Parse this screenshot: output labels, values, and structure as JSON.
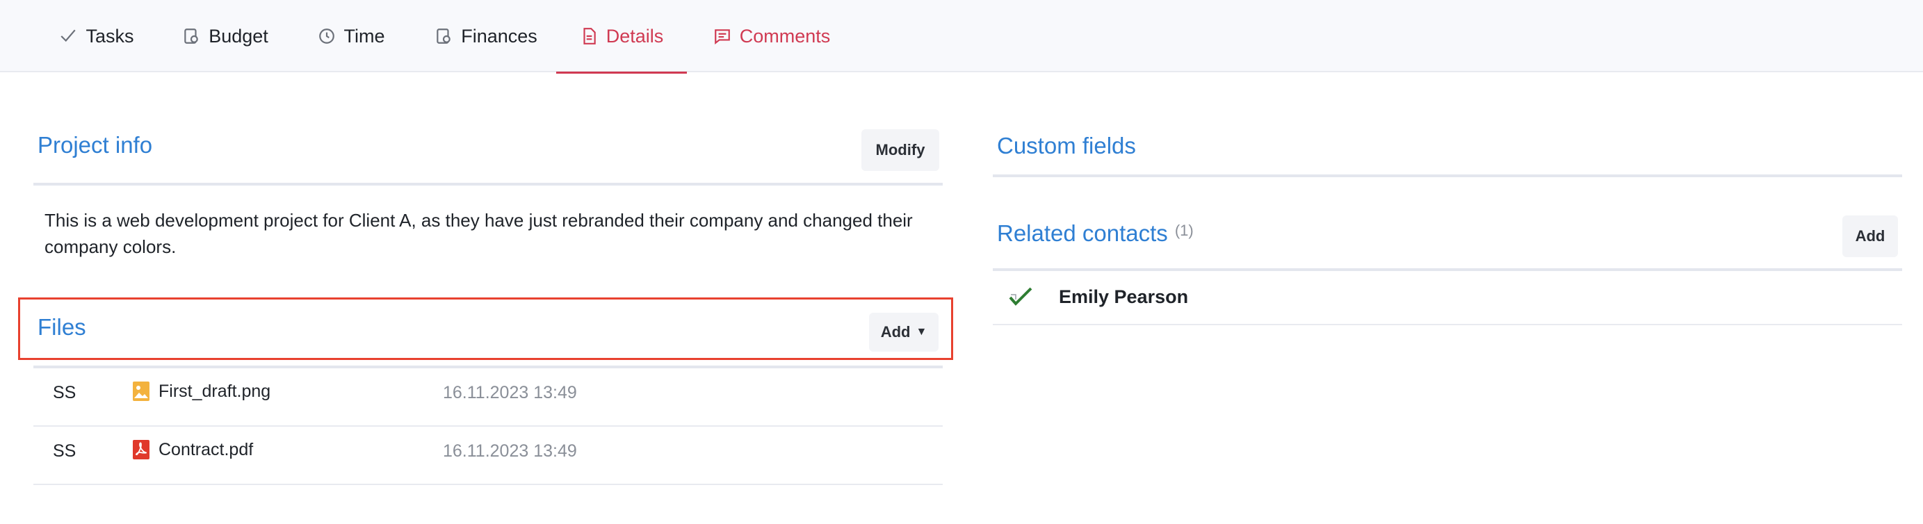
{
  "tabs": [
    {
      "label": "Tasks",
      "icon": "check-icon"
    },
    {
      "label": "Budget",
      "icon": "budget-icon"
    },
    {
      "label": "Time",
      "icon": "clock-icon"
    },
    {
      "label": "Finances",
      "icon": "finances-icon"
    },
    {
      "label": "Details",
      "icon": "document-icon",
      "active": true
    },
    {
      "label": "Comments",
      "icon": "comment-icon"
    }
  ],
  "project_info": {
    "title": "Project info",
    "modify_label": "Modify",
    "description": "This is a web development project for Client A, as they have just rebranded their company and changed their company colors."
  },
  "files": {
    "title": "Files",
    "add_label": "Add",
    "items": [
      {
        "owner": "SS",
        "name": "First_draft.png",
        "type": "image",
        "date": "16.11.2023 13:49"
      },
      {
        "owner": "SS",
        "name": "Contract.pdf",
        "type": "pdf",
        "date": "16.11.2023 13:49"
      }
    ]
  },
  "custom_fields": {
    "title": "Custom fields"
  },
  "related_contacts": {
    "title": "Related contacts",
    "count": "(1)",
    "add_label": "Add",
    "items": [
      {
        "name": "Emily Pearson"
      }
    ]
  },
  "colors": {
    "accent_blue": "#2f7fd3",
    "accent_red": "#d03a52",
    "highlight": "#e8412f",
    "check_green": "#2e7d32"
  }
}
